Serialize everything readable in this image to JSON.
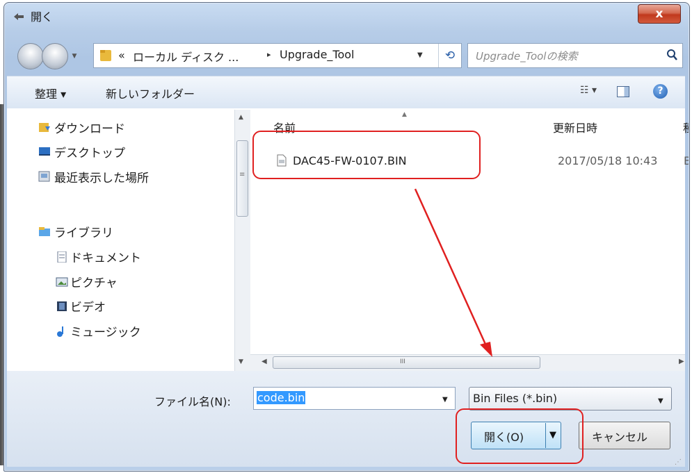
{
  "window": {
    "title": "開く",
    "close_label": "x"
  },
  "address": {
    "chevron": "«",
    "disk_label": "ローカル ディスク ...",
    "separator": "▸",
    "current_folder": "Upgrade_Tool",
    "search_placeholder": "Upgrade_Toolの検索"
  },
  "toolbar": {
    "organize_label": "整理 ▾",
    "new_folder_label": "新しいフォルダー",
    "view_label": "☷ ▾",
    "help_label": "?"
  },
  "nav_pane": {
    "items": [
      {
        "label": "ダウンロード",
        "icon": "download-folder-icon"
      },
      {
        "label": "デスクトップ",
        "icon": "desktop-icon"
      },
      {
        "label": "最近表示した場所",
        "icon": "recent-places-icon"
      },
      {
        "label": "ライブラリ",
        "icon": "library-icon"
      },
      {
        "label": "ドキュメント",
        "icon": "documents-icon"
      },
      {
        "label": "ピクチャ",
        "icon": "pictures-icon"
      },
      {
        "label": "ビデオ",
        "icon": "videos-icon"
      },
      {
        "label": "ミュージック",
        "icon": "music-icon"
      }
    ],
    "scroll_grip": "≡"
  },
  "file_list": {
    "columns": {
      "name": "名前",
      "date": "更新日時",
      "more": "種"
    },
    "rows": [
      {
        "name": "DAC45-FW-0107.BIN",
        "date": "2017/05/18 10:43",
        "more": "B"
      }
    ],
    "hscroll_grip": "III"
  },
  "bottom": {
    "filename_label": "ファイル名(N):",
    "filename_value": "code.bin",
    "filetype_value": "Bin Files (*.bin)",
    "open_label": "開く(O)",
    "cancel_label": "キャンセル"
  },
  "colors": {
    "annotation": "#e02020",
    "selection": "#3399ff",
    "close_button": "#c0391d"
  }
}
